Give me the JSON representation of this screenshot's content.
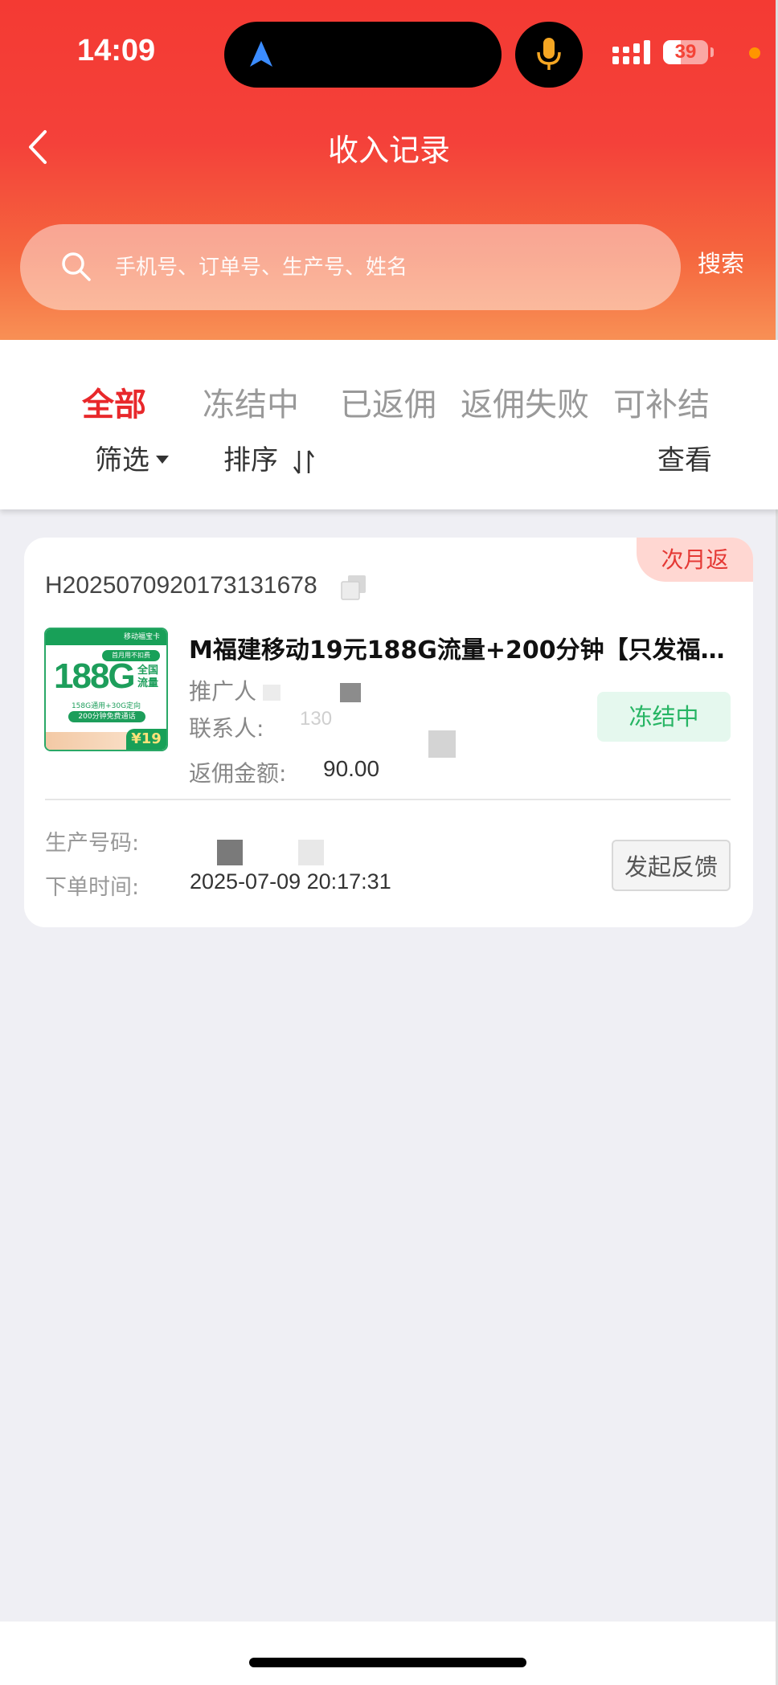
{
  "status_bar": {
    "time": "14:09",
    "battery": "39",
    "battery_fraction": 0.39,
    "icons": [
      "navigation-arrow-icon",
      "microphone-icon",
      "signal-icon",
      "battery-icon"
    ]
  },
  "nav": {
    "title": "收入记录",
    "back_icon": "chevron-left-icon"
  },
  "search": {
    "placeholder": "手机号、订单号、生产号、姓名",
    "button_label": "搜索",
    "icon": "search-icon"
  },
  "tabs": [
    {
      "label": "全部",
      "active": true
    },
    {
      "label": "冻结中",
      "active": false
    },
    {
      "label": "已返佣",
      "active": false
    },
    {
      "label": "返佣失败",
      "active": false
    },
    {
      "label": "可补结",
      "active": false
    }
  ],
  "filters": {
    "filter_label": "筛选",
    "sort_label": "排序",
    "view_label": "查看"
  },
  "colors": {
    "header_red": "#f43a33",
    "active_tab": "#e8282b",
    "status_green": "#27b564",
    "status_bg": "#e5f8ee",
    "list_bg": "#efeff4"
  },
  "records": [
    {
      "badge": "次月返",
      "order_no": "H2025070920173131678",
      "product": {
        "title": "M福建移动19元188G流量+200分钟【只发福…",
        "thumb_header": "移动福宝卡",
        "thumb_sub": "首月用不扣费",
        "thumb_big": "188G",
        "thumb_side": "全国流量",
        "thumb_line1": "158G通用+30G定向",
        "thumb_line2": "200分钟免费通话",
        "thumb_price": "¥19"
      },
      "promoter_label": "推广人",
      "contact_label": "联系人:",
      "contact_value": "130",
      "rebate_label": "返佣金额:",
      "rebate_value": "90.00",
      "status": "冻结中",
      "production_label": "生产号码:",
      "order_time_label": "下单时间:",
      "order_time": "2025-07-09 20:17:31",
      "feedback_label": "发起反馈"
    }
  ]
}
